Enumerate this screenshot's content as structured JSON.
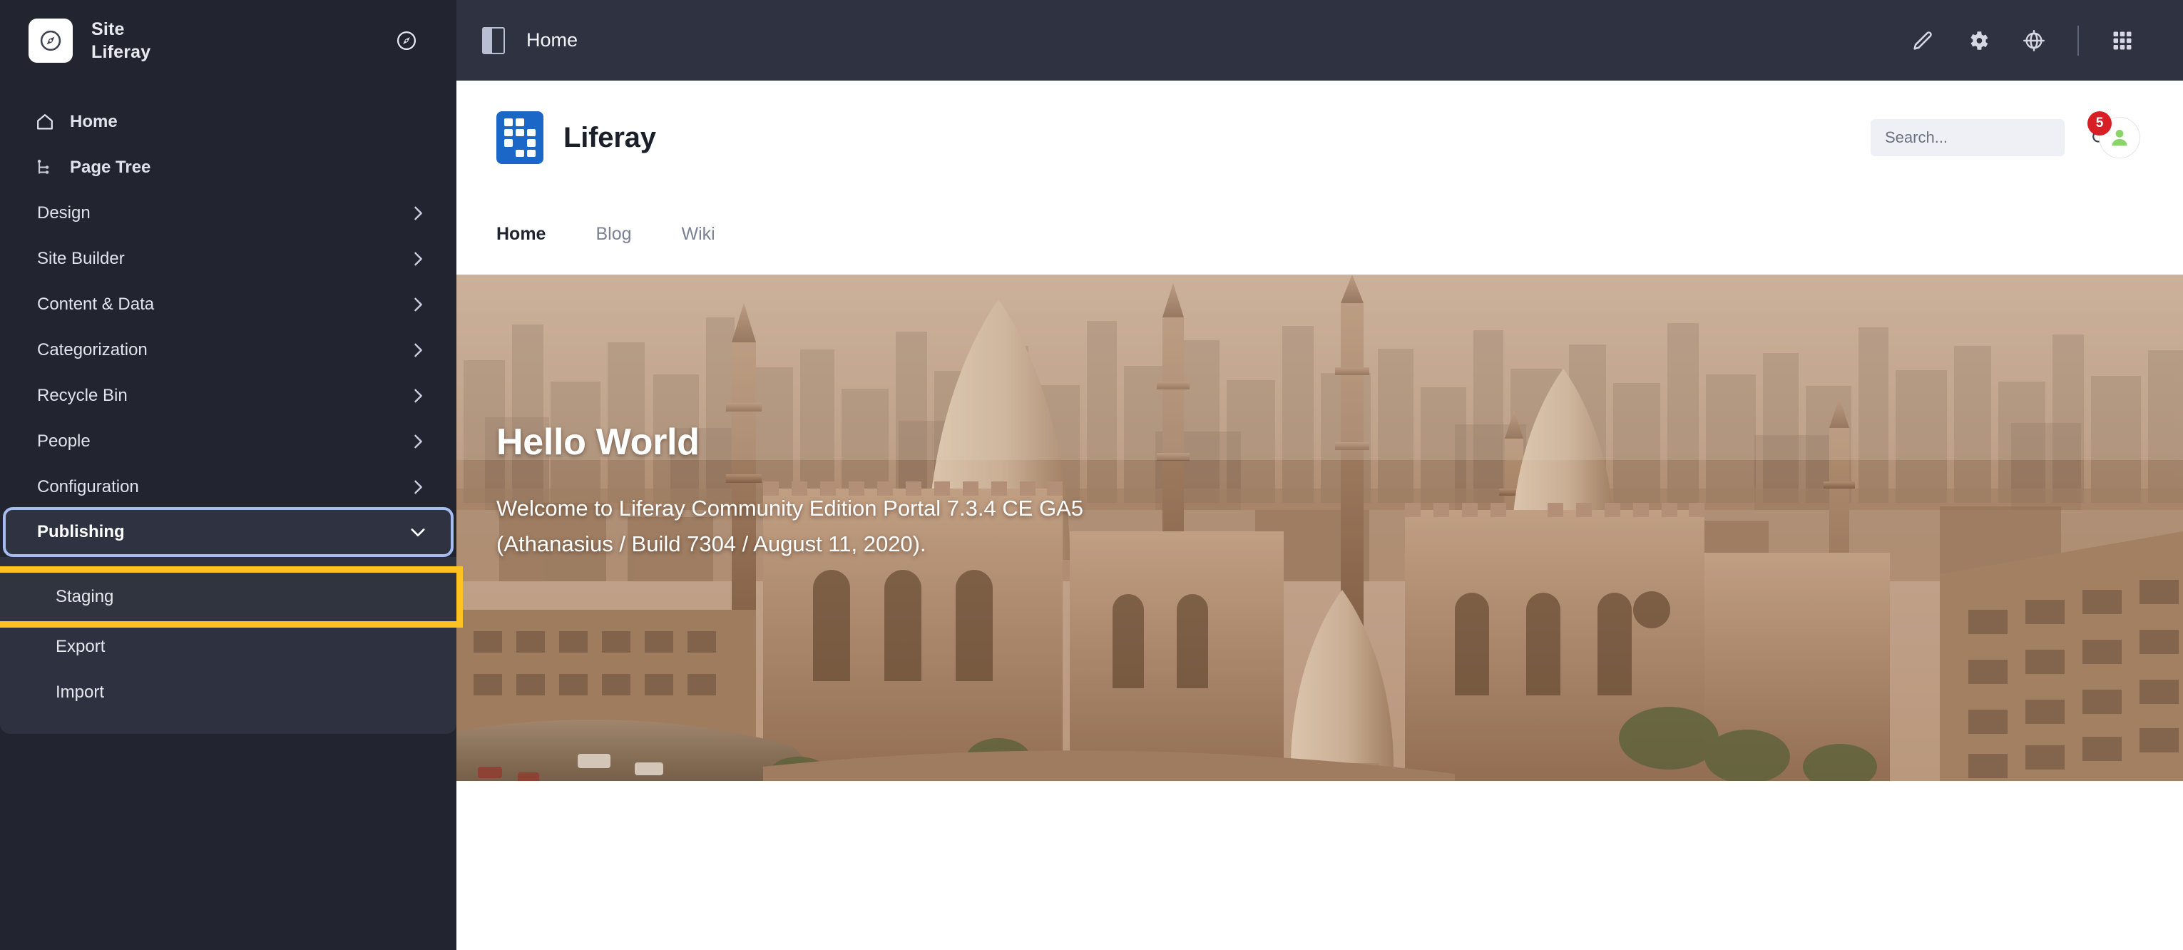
{
  "sidebar": {
    "logo_icon": "compass-icon",
    "title_line1": "Site",
    "title_line2": "Liferay",
    "header_action_icon": "compass-outline-icon",
    "top_links": [
      {
        "label": "Home",
        "icon": "home-icon"
      },
      {
        "label": "Page Tree",
        "icon": "page-tree-icon"
      }
    ],
    "items": [
      {
        "label": "Design",
        "icon": "chevron-right-icon"
      },
      {
        "label": "Site Builder",
        "icon": "chevron-right-icon"
      },
      {
        "label": "Content & Data",
        "icon": "chevron-right-icon"
      },
      {
        "label": "Categorization",
        "icon": "chevron-right-icon"
      },
      {
        "label": "Recycle Bin",
        "icon": "chevron-right-icon"
      },
      {
        "label": "People",
        "icon": "chevron-right-icon"
      },
      {
        "label": "Configuration",
        "icon": "chevron-right-icon"
      }
    ],
    "expanded": {
      "label": "Publishing",
      "icon": "chevron-down-icon",
      "focus_ring_color": "#a7bdf0",
      "children": [
        {
          "label": "Staging",
          "highlighted": true
        },
        {
          "label": "Export",
          "highlighted": false
        },
        {
          "label": "Import",
          "highlighted": false
        }
      ]
    },
    "highlight_color": "#ffc220",
    "background_color": "#22252f",
    "submenu_background_color": "#2e3240"
  },
  "topbar": {
    "toggle_icon": "sidebar-panel-icon",
    "title": "Home",
    "background_color": "#2e3241",
    "actions": [
      {
        "name": "edit-pencil-icon"
      },
      {
        "name": "gear-icon"
      },
      {
        "name": "globe-target-icon"
      },
      {
        "name": "divider"
      },
      {
        "name": "grid-apps-icon"
      }
    ]
  },
  "page_header": {
    "logo_icon": "liferay-logo-icon",
    "logo_color": "#1b67c8",
    "brand": "Liferay",
    "search": {
      "placeholder": "Search...",
      "value": "",
      "icon": "search-icon"
    },
    "avatar": {
      "icon": "user-avatar-icon",
      "badge_count": "5",
      "badge_color": "#d81f26"
    },
    "tabs": [
      {
        "label": "Home",
        "active": true
      },
      {
        "label": "Blog",
        "active": false
      },
      {
        "label": "Wiki",
        "active": false
      }
    ]
  },
  "hero": {
    "title": "Hello World",
    "subtitle_line1": "Welcome to Liferay Community Edition Portal 7.3.4 CE GA5",
    "subtitle_line2": "(Athanasius / Build 7304 / August 11, 2020)."
  }
}
